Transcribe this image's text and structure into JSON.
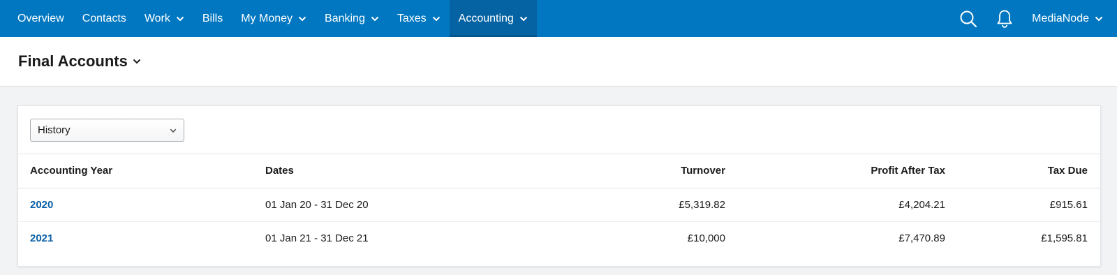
{
  "nav": {
    "items": [
      {
        "label": "Overview",
        "dropdown": false,
        "active": false
      },
      {
        "label": "Contacts",
        "dropdown": false,
        "active": false
      },
      {
        "label": "Work",
        "dropdown": true,
        "active": false
      },
      {
        "label": "Bills",
        "dropdown": false,
        "active": false
      },
      {
        "label": "My Money",
        "dropdown": true,
        "active": false
      },
      {
        "label": "Banking",
        "dropdown": true,
        "active": false
      },
      {
        "label": "Taxes",
        "dropdown": true,
        "active": false
      },
      {
        "label": "Accounting",
        "dropdown": true,
        "active": true
      }
    ],
    "search_icon": "search-icon",
    "notifications_icon": "bell-icon",
    "user_label": "MediaNode"
  },
  "page": {
    "title": "Final Accounts"
  },
  "filter": {
    "selected": "History"
  },
  "table": {
    "headers": [
      "Accounting Year",
      "Dates",
      "Turnover",
      "Profit After Tax",
      "Tax Due"
    ],
    "rows": [
      {
        "year": "2020",
        "dates": "01 Jan 20 - 31 Dec 20",
        "turnover": "£5,319.82",
        "profit": "£4,204.21",
        "tax": "£915.61"
      },
      {
        "year": "2021",
        "dates": "01 Jan 21 - 31 Dec 21",
        "turnover": "£10,000",
        "profit": "£7,470.89",
        "tax": "£1,595.81"
      }
    ]
  },
  "colors": {
    "nav_bg": "#0077c0",
    "nav_active_bg": "#0563a3",
    "link": "#0a5fa8",
    "page_bg": "#f2f3f5"
  }
}
